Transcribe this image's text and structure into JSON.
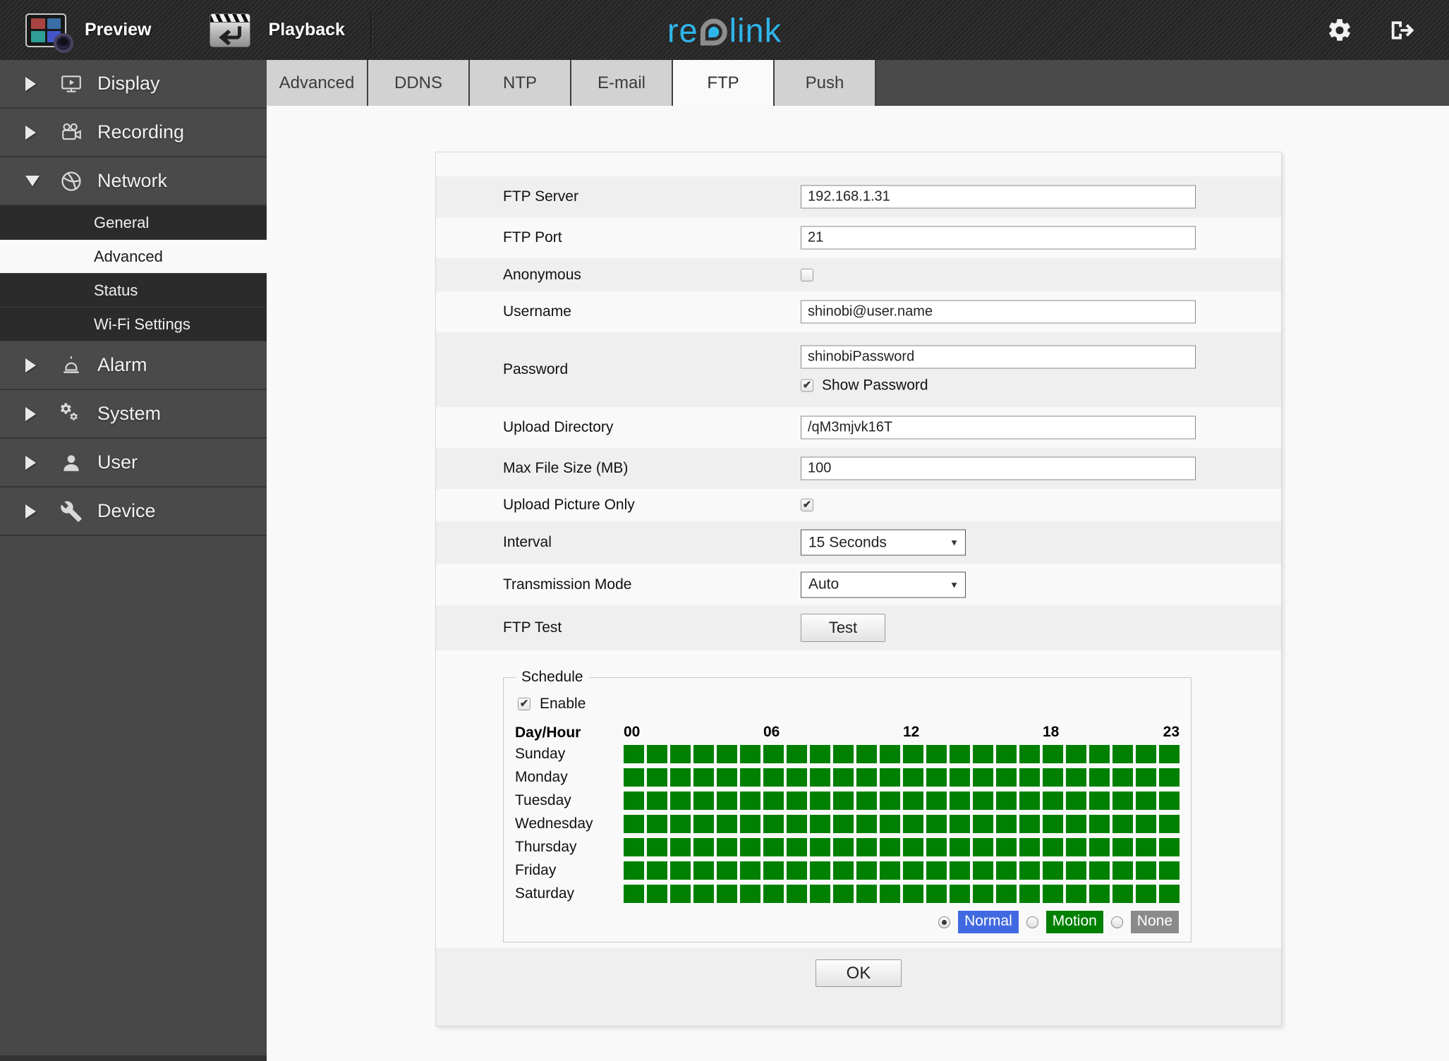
{
  "topbar": {
    "preview": "Preview",
    "playback": "Playback",
    "brand_left": "re",
    "brand_right": "link"
  },
  "sidebar": {
    "items": [
      {
        "label": "Display",
        "icon": "display-icon",
        "expanded": false
      },
      {
        "label": "Recording",
        "icon": "recording-icon",
        "expanded": false
      },
      {
        "label": "Network",
        "icon": "network-icon",
        "expanded": true,
        "children": [
          {
            "label": "General",
            "selected": false
          },
          {
            "label": "Advanced",
            "selected": true
          },
          {
            "label": "Status",
            "selected": false
          },
          {
            "label": "Wi-Fi Settings",
            "selected": false
          }
        ]
      },
      {
        "label": "Alarm",
        "icon": "alarm-icon",
        "expanded": false
      },
      {
        "label": "System",
        "icon": "system-icon",
        "expanded": false
      },
      {
        "label": "User",
        "icon": "user-icon",
        "expanded": false
      },
      {
        "label": "Device",
        "icon": "device-icon",
        "expanded": false
      }
    ]
  },
  "tabs": {
    "items": [
      "Advanced",
      "DDNS",
      "NTP",
      "E-mail",
      "FTP",
      "Push"
    ],
    "active": "FTP"
  },
  "form": {
    "ftp_server": {
      "label": "FTP Server",
      "value": "192.168.1.31"
    },
    "ftp_port": {
      "label": "FTP Port",
      "value": "21"
    },
    "anonymous": {
      "label": "Anonymous",
      "checked": false
    },
    "username": {
      "label": "Username",
      "value": "shinobi@user.name"
    },
    "password": {
      "label": "Password",
      "value": "shinobiPassword",
      "show_password_label": "Show Password",
      "show_password_checked": true
    },
    "upload_directory": {
      "label": "Upload Directory",
      "value": "/qM3mjvk16T"
    },
    "max_file_size": {
      "label": "Max File Size (MB)",
      "value": "100"
    },
    "upload_picture_only": {
      "label": "Upload Picture Only",
      "checked": true
    },
    "interval": {
      "label": "Interval",
      "value": "15 Seconds"
    },
    "transmission_mode": {
      "label": "Transmission Mode",
      "value": "Auto"
    },
    "ftp_test": {
      "label": "FTP Test",
      "button_label": "Test"
    }
  },
  "schedule": {
    "legend": "Schedule",
    "enable_label": "Enable",
    "enable_checked": true,
    "header_label": "Day/Hour",
    "hour_labels": [
      "00",
      "06",
      "12",
      "18",
      "23"
    ],
    "days": [
      "Sunday",
      "Monday",
      "Tuesday",
      "Wednesday",
      "Thursday",
      "Friday",
      "Saturday"
    ],
    "hours_per_day": 24,
    "all_cells_filled": true,
    "cell_color": "#008000",
    "modes": [
      {
        "label": "Normal",
        "color": "#4169e1",
        "selected": true
      },
      {
        "label": "Motion",
        "color": "#008000",
        "selected": false
      },
      {
        "label": "None",
        "color": "#8a8a8a",
        "selected": false
      }
    ]
  },
  "ok_label": "OK"
}
